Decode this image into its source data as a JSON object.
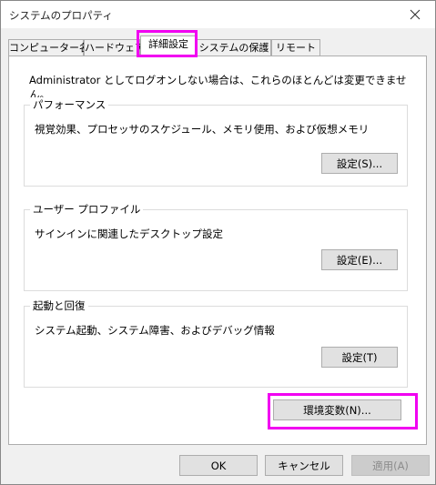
{
  "window": {
    "title": "システムのプロパティ"
  },
  "tabs": [
    {
      "label": "コンピューター名"
    },
    {
      "label": "ハードウェア"
    },
    {
      "label": "詳細設定"
    },
    {
      "label": "システムの保護"
    },
    {
      "label": "リモート"
    }
  ],
  "active_tab": "詳細設定",
  "admin_note": "Administrator としてログオンしない場合は、これらのほとんどは変更できません。",
  "groups": {
    "performance": {
      "title": "パフォーマンス",
      "desc": "視覚効果、プロセッサのスケジュール、メモリ使用、および仮想メモリ",
      "button": "設定(S)..."
    },
    "profile": {
      "title": "ユーザー プロファイル",
      "desc": "サインインに関連したデスクトップ設定",
      "button": "設定(E)..."
    },
    "startup": {
      "title": "起動と回復",
      "desc": "システム起動、システム障害、およびデバッグ情報",
      "button": "設定(T)"
    }
  },
  "env_button": "環境変数(N)...",
  "footer": {
    "ok": "OK",
    "cancel": "キャンセル",
    "apply": "適用(A)"
  },
  "colors": {
    "highlight": "#f100f1",
    "panel_bg": "#ffffff",
    "dialog_bg": "#f0f0f0"
  },
  "icons": {
    "close": "close-icon"
  }
}
